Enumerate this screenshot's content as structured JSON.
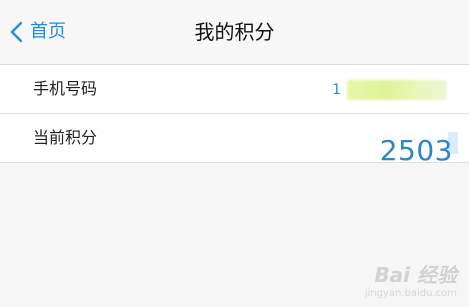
{
  "navbar": {
    "back_label": "首页",
    "title": "我的积分"
  },
  "rows": [
    {
      "label": "手机号码",
      "value_visible_prefix": "1"
    },
    {
      "label": "当前积分",
      "value": "2503"
    }
  ],
  "watermark": {
    "main": "Bai 经验",
    "sub": "jingyan.baidu.com"
  },
  "colors": {
    "accent": "#1e8ee0",
    "points": "#2c85cf",
    "background": "#f6f6f6"
  },
  "icons": {
    "back": "chevron-left-icon"
  }
}
